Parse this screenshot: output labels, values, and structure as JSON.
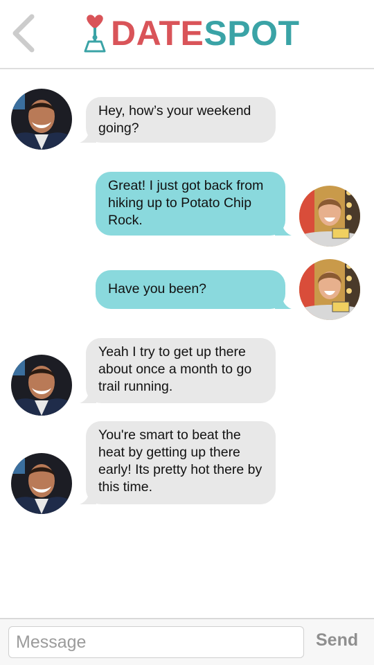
{
  "header": {
    "back_icon": "chevron-left-icon",
    "logo_icon": "heart-joystick-icon",
    "logo_part1": "DATE",
    "logo_part2": "SPOT",
    "colors": {
      "date": "#d95459",
      "spot": "#3aa3a6",
      "back": "#cccccc"
    }
  },
  "messages": [
    {
      "sender": "them",
      "text": "Hey, how’s your weekend going?",
      "avatar": "man-avatar"
    },
    {
      "sender": "me",
      "text": "Great! I just got back from hiking up to Potato Chip Rock.",
      "avatar": "woman-avatar"
    },
    {
      "sender": "me",
      "text": "Have you been?",
      "avatar": "woman-avatar"
    },
    {
      "sender": "them",
      "text": "Yeah I try to get up there about once a month to go trail running.",
      "avatar": "man-avatar"
    },
    {
      "sender": "them",
      "text": "You're smart to beat the heat by getting up there early! Its pretty hot there by this time.",
      "avatar": "man-avatar"
    }
  ],
  "composer": {
    "placeholder": "Message",
    "value": "",
    "send_label": "Send"
  },
  "colors": {
    "incoming_bubble": "#e8e8e8",
    "outgoing_bubble": "#8ad9dd"
  }
}
